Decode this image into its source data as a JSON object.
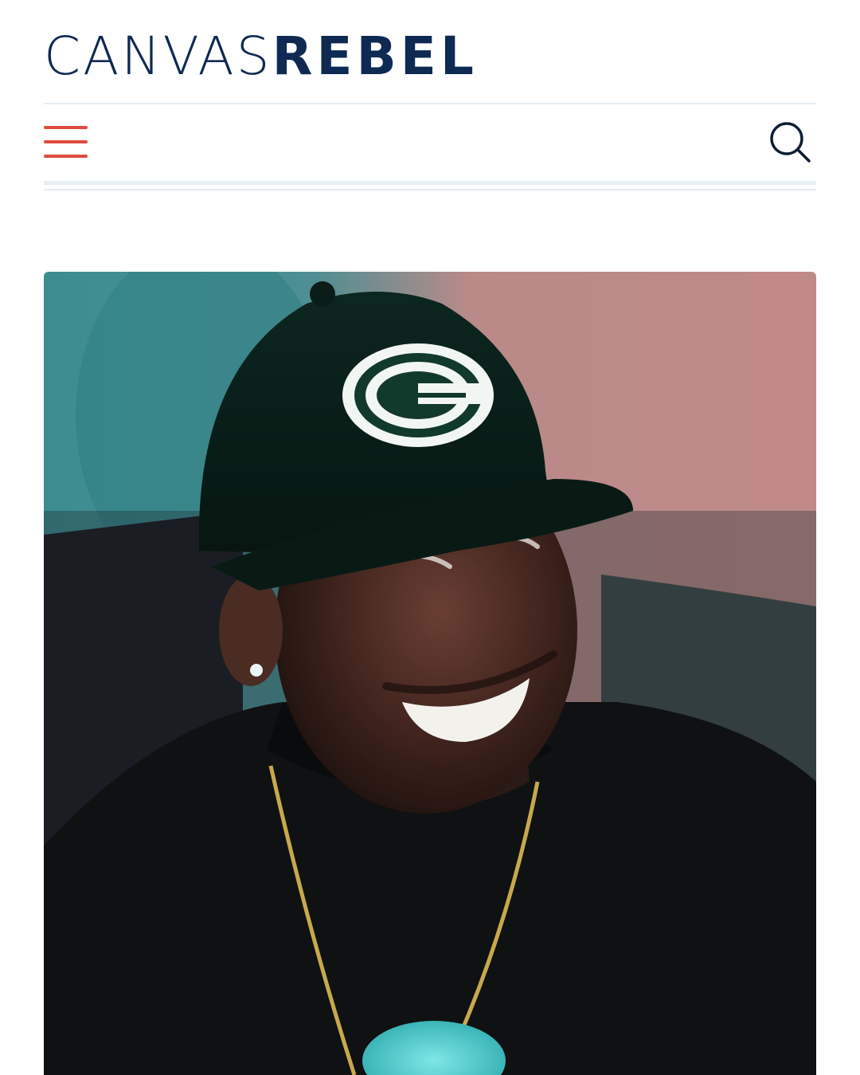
{
  "header": {
    "logo_light": "CANVAS",
    "logo_bold": "REBEL",
    "brand_color": "#0e2a52",
    "accent_color": "#e04b3f"
  },
  "nav": {
    "menu_icon": "hamburger-menu-icon",
    "search_icon": "search-icon"
  },
  "hero": {
    "image": "smiling-man-green-cap-photo",
    "cap_logo_text": "G"
  }
}
